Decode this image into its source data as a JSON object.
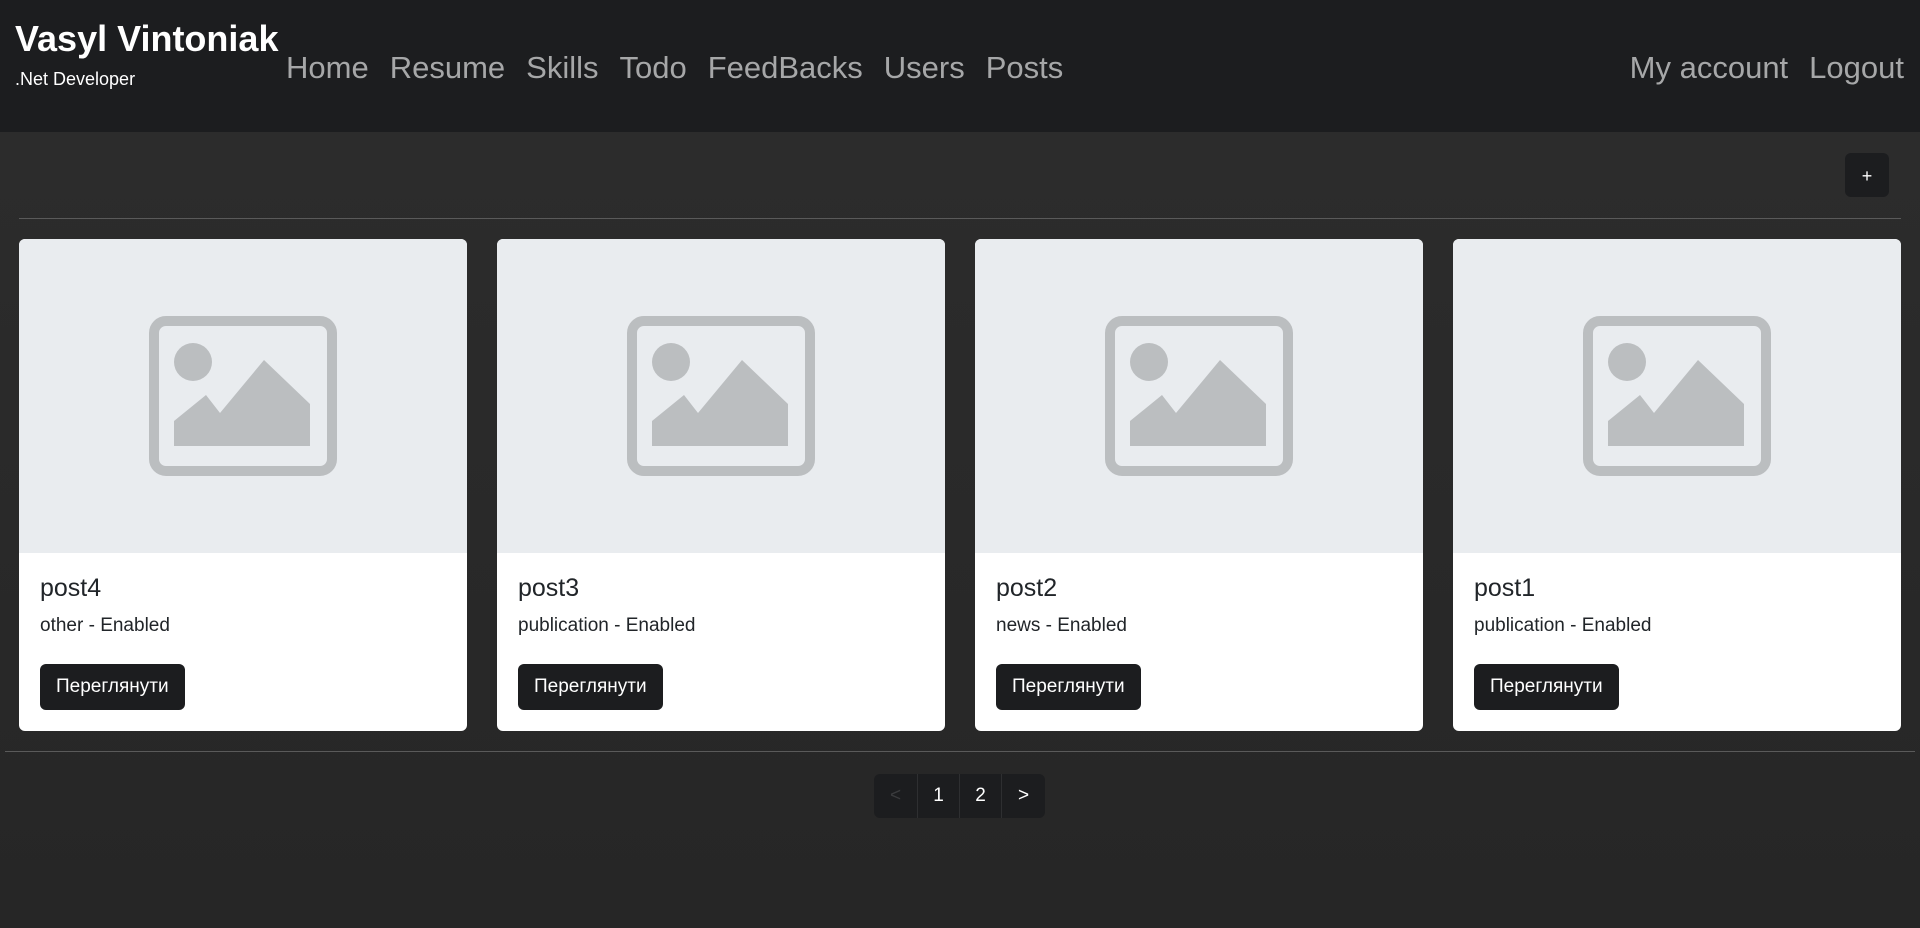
{
  "brand": {
    "name": "Vasyl Vintoniak",
    "subtitle": ".Net Developer"
  },
  "nav": {
    "links": [
      "Home",
      "Resume",
      "Skills",
      "Todo",
      "FeedBacks",
      "Users",
      "Posts"
    ],
    "right": [
      "My account",
      "Logout"
    ]
  },
  "toolbar": {
    "add_label": "+"
  },
  "posts": [
    {
      "title": "post4",
      "category": "other",
      "status": "Enabled",
      "subtitle": "other - Enabled",
      "button": "Переглянути"
    },
    {
      "title": "post3",
      "category": "publication",
      "status": "Enabled",
      "subtitle": "publication - Enabled",
      "button": "Переглянути"
    },
    {
      "title": "post2",
      "category": "news",
      "status": "Enabled",
      "subtitle": "news - Enabled",
      "button": "Переглянути"
    },
    {
      "title": "post1",
      "category": "publication",
      "status": "Enabled",
      "subtitle": "publication - Enabled",
      "button": "Переглянути"
    }
  ],
  "pagination": {
    "prev": "<",
    "pages": [
      "1",
      "2"
    ],
    "next": ">"
  },
  "colors": {
    "navbar": "#1c1d1f",
    "background": "#272727",
    "card": "#ffffff",
    "placeholder": "#e9ecef",
    "placeholder_icon": "#bbbec0",
    "button": "#1c1d1f",
    "nav_text": "#a6a7a8"
  },
  "icons": {
    "card_image": "image-placeholder-icon"
  }
}
